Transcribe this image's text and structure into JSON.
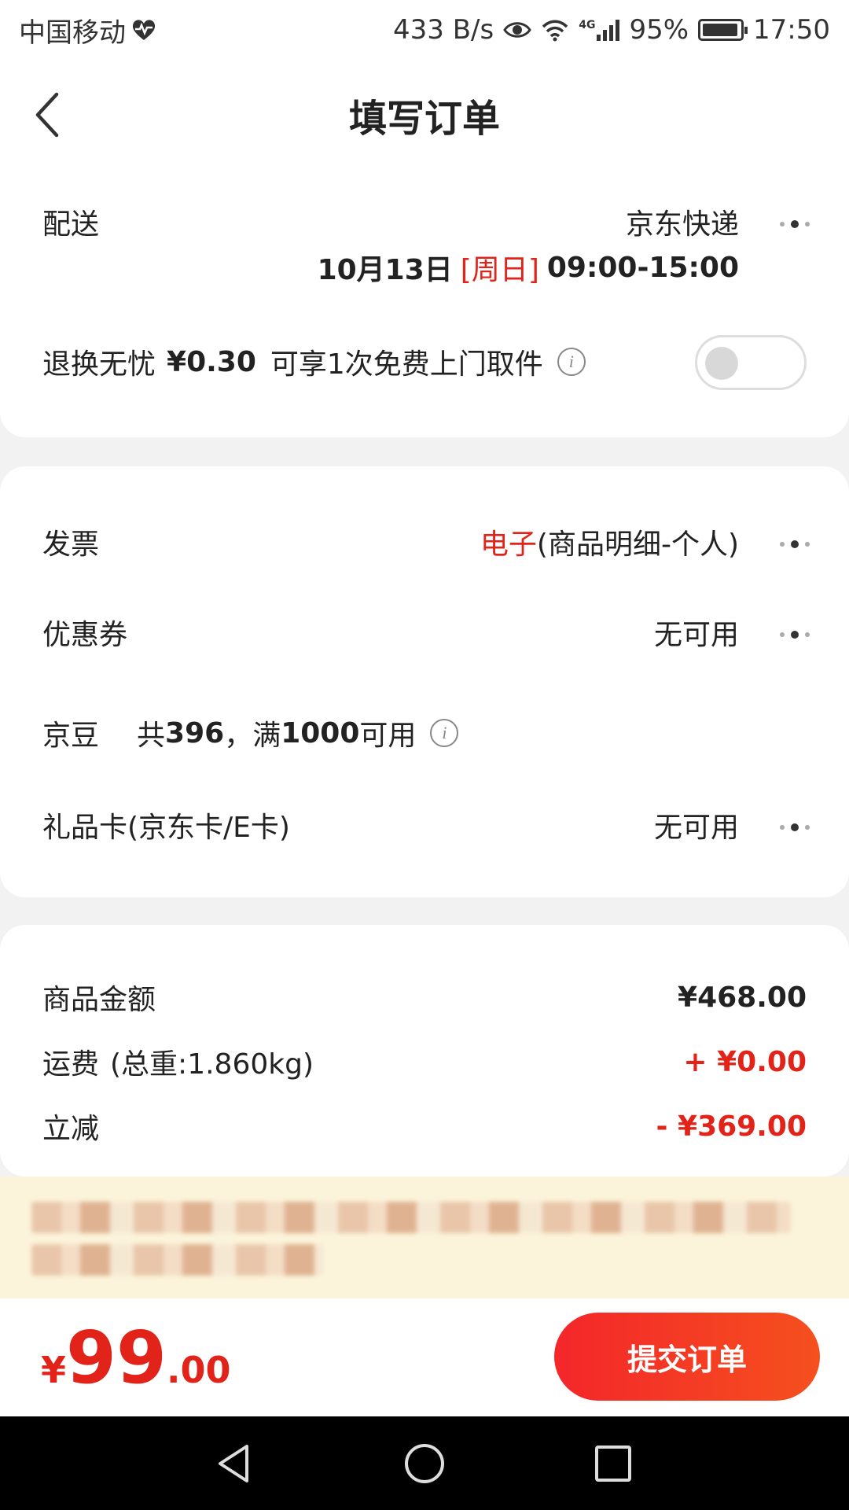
{
  "status_bar": {
    "carrier": "中国移动",
    "speed": "433 B/s",
    "network": "4G",
    "battery": "95%",
    "time": "17:50"
  },
  "header": {
    "title": "填写订单"
  },
  "delivery": {
    "label": "配送",
    "method": "京东快递",
    "date": "10月13日",
    "weekday": "[周日]",
    "time_range": "09:00-15:00"
  },
  "return_service": {
    "label": "退换无忧",
    "price": "¥0.30",
    "desc": "可享1次免费上门取件",
    "enabled": false
  },
  "invoice": {
    "label": "发票",
    "type": "电子",
    "detail": "(商品明细-个人)"
  },
  "coupon": {
    "label": "优惠券",
    "value": "无可用"
  },
  "jd_beans": {
    "label": "京豆",
    "prefix": "共",
    "count": "396",
    "sep": "，满",
    "threshold": "1000",
    "suffix": "可用"
  },
  "gift_card": {
    "label": "礼品卡(京东卡/E卡)",
    "value": "无可用"
  },
  "summary": {
    "goods_label": "商品金额",
    "goods_value": "¥468.00",
    "shipping_label": "运费",
    "shipping_weight": "(总重:1.860kg)",
    "shipping_value": "+ ¥0.00",
    "discount_label": "立减",
    "discount_value": "- ¥369.00"
  },
  "footer": {
    "yen": "¥",
    "total_int": "99",
    "total_dec": ".00",
    "submit_label": "提交订单"
  },
  "colors": {
    "accent": "#e2231a",
    "notice_bg": "#fbf4da"
  }
}
